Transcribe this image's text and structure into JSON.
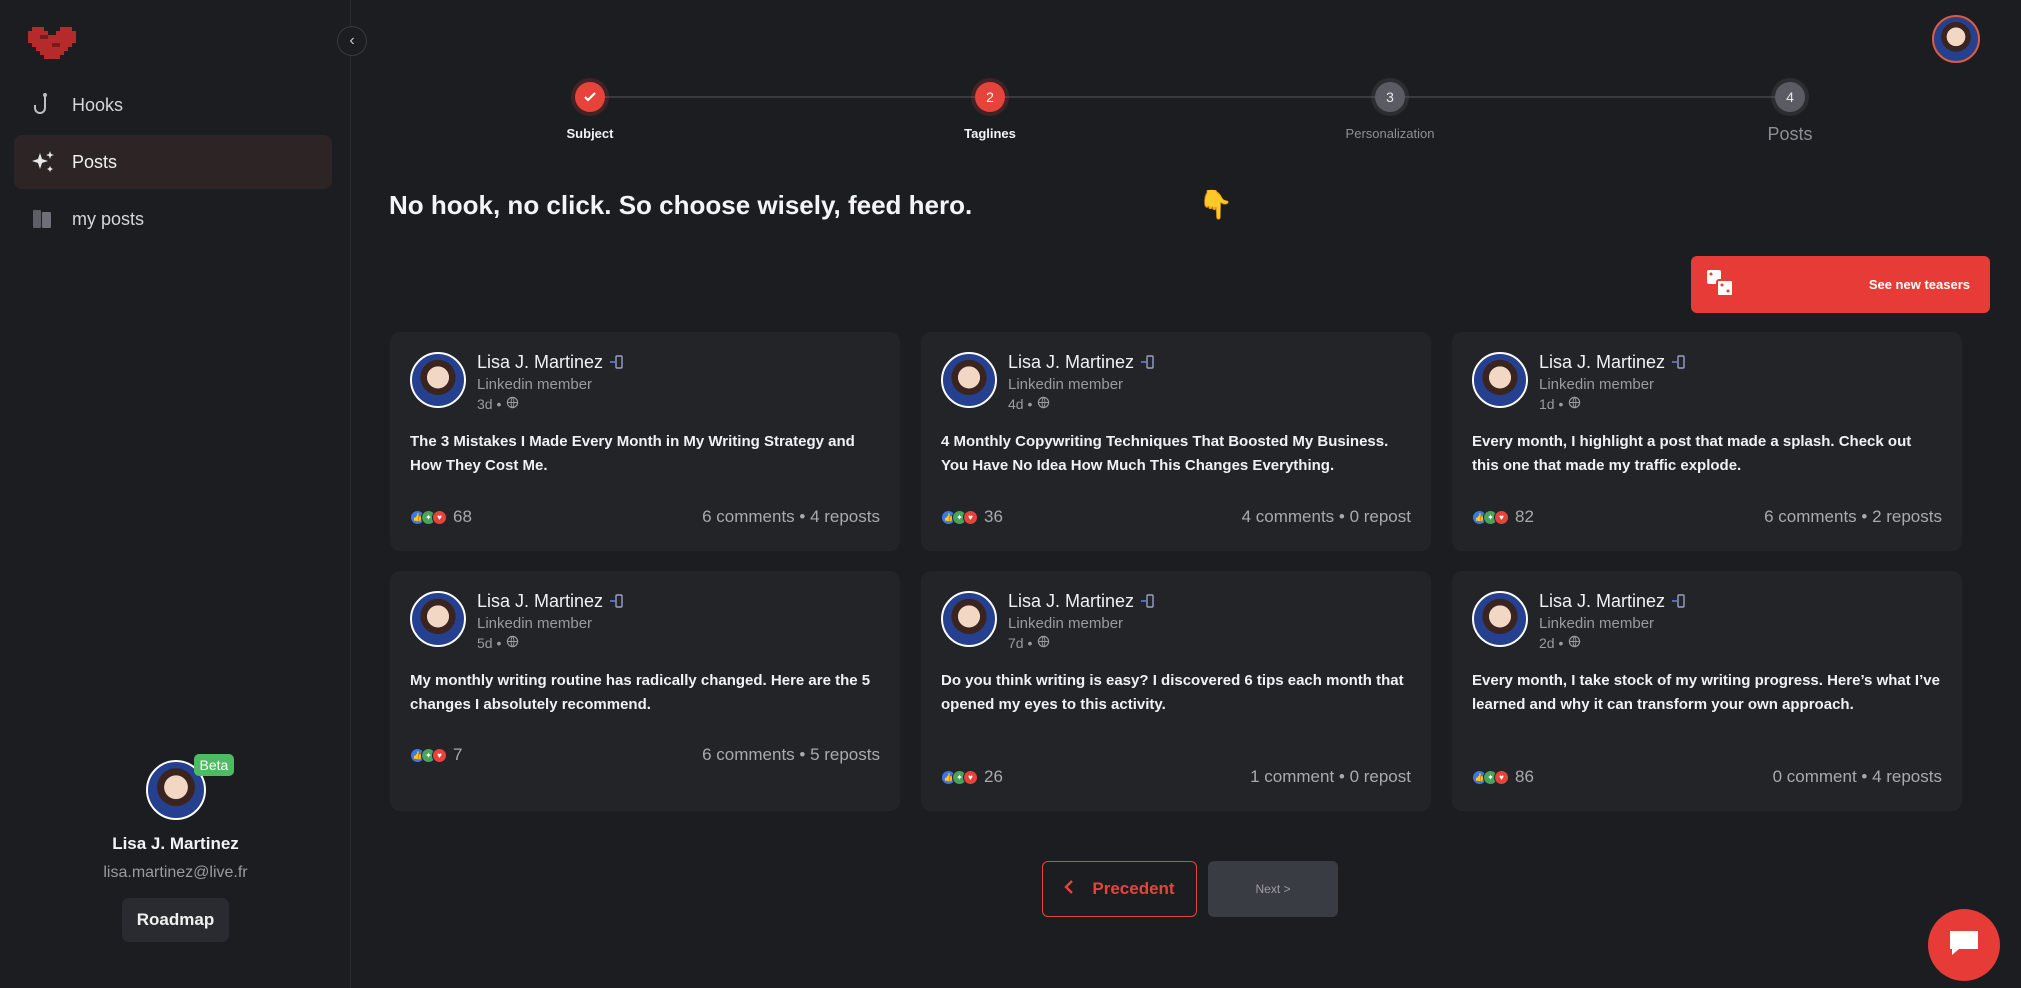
{
  "colors": {
    "accent": "#e63b36",
    "beta": "#4dbb5f",
    "background": "#1c1d21",
    "card": "#232428"
  },
  "sidebar": {
    "logo_icon": "pixel-heart-icon",
    "collapse_icon": "chevron-left-icon",
    "items": [
      {
        "label": "Hooks",
        "icon": "hook-icon",
        "active": false
      },
      {
        "label": "Posts",
        "icon": "sparkles-icon",
        "active": true
      },
      {
        "label": "my posts",
        "icon": "folder-icon",
        "active": false
      }
    ],
    "profile": {
      "beta_label": "Beta",
      "name": "Lisa J. Martinez",
      "email": "lisa.martinez@live.fr",
      "roadmap_label": "Roadmap"
    }
  },
  "stepper": {
    "steps": [
      {
        "number": "",
        "label": "Subject",
        "state": "done"
      },
      {
        "number": "2",
        "label": "Taglines",
        "state": "current"
      },
      {
        "number": "3",
        "label": "Personalization",
        "state": "todo"
      },
      {
        "number": "4",
        "label": "Posts",
        "state": "todo"
      }
    ]
  },
  "main": {
    "heading": "No hook, no click. So choose wisely, feed hero.",
    "pointer_emoji": "👇",
    "teaser_button_label": "See new teasers"
  },
  "posts": [
    {
      "author": "Lisa J. Martinez",
      "role": "Linkedin member",
      "time": "3d",
      "text": "The 3 Mistakes I Made Every Month in My Writing Strategy and How They Cost Me.",
      "reactions": "68",
      "stats": "6 comments • 4 reposts"
    },
    {
      "author": "Lisa J. Martinez",
      "role": "Linkedin member",
      "time": "4d",
      "text": "4 Monthly Copywriting Techniques That Boosted My Business. You Have No Idea How Much This Changes Everything.",
      "reactions": "36",
      "stats": "4 comments • 0 repost"
    },
    {
      "author": "Lisa J. Martinez",
      "role": "Linkedin member",
      "time": "1d",
      "text": "Every month, I highlight a post that made a splash. Check out this one that made my traffic explode.",
      "reactions": "82",
      "stats": "6 comments • 2 reposts"
    },
    {
      "author": "Lisa J. Martinez",
      "role": "Linkedin member",
      "time": "5d",
      "text": "My monthly writing routine has radically changed. Here are the 5 changes I absolutely recommend.",
      "reactions": "7",
      "stats": "6 comments • 5 reposts"
    },
    {
      "author": "Lisa J. Martinez",
      "role": "Linkedin member",
      "time": "7d",
      "text": "Do you think writing is easy? I discovered 6 tips each month that opened my eyes to this activity.",
      "reactions": "26",
      "stats": "1 comment • 0 repost"
    },
    {
      "author": "Lisa J. Martinez",
      "role": "Linkedin member",
      "time": "2d",
      "text": "Every month, I take stock of my writing progress. Here’s what I’ve learned and why it can transform your own approach.",
      "reactions": "86",
      "stats": "0 comment • 4 reposts"
    }
  ],
  "pagination": {
    "prev_label": "Precedent",
    "next_label": "Next >"
  }
}
